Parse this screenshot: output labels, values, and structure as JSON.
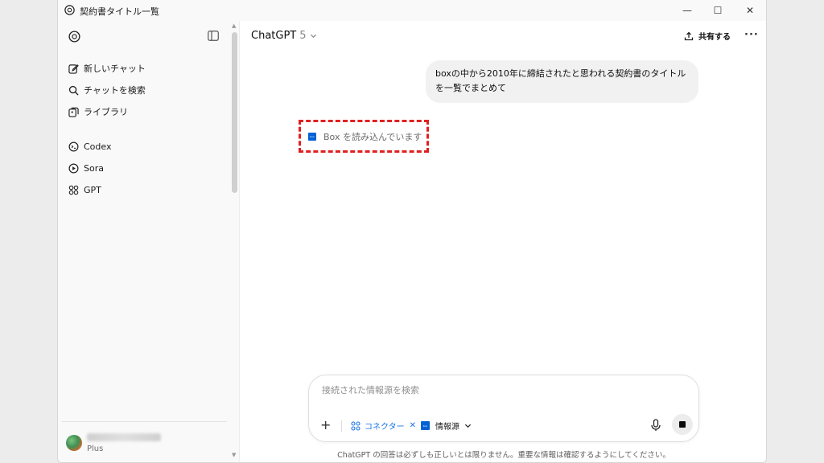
{
  "window": {
    "title": "契約書タイトル一覧",
    "controls": {
      "minimize": "—",
      "maximize": "☐",
      "close": "✕"
    }
  },
  "sidebar": {
    "items": [
      {
        "label": "新しいチャット",
        "icon": "edit-icon"
      },
      {
        "label": "チャットを検索",
        "icon": "search-icon"
      },
      {
        "label": "ライブラリ",
        "icon": "library-icon"
      },
      {
        "label": "Codex",
        "icon": "codex-icon"
      },
      {
        "label": "Sora",
        "icon": "sora-play-icon"
      },
      {
        "label": "GPT",
        "icon": "gpt-grid-icon"
      }
    ],
    "profile": {
      "plan": "Plus"
    }
  },
  "header": {
    "model_name": "ChatGPT",
    "model_version": "5",
    "share_label": "共有する",
    "more_label": "···"
  },
  "conversation": {
    "user_message": "boxの中から2010年に締結されたと思われる契約書のタイトルを一覧でまとめて",
    "status": {
      "icon_text": "box",
      "text": "Box を読み込んでいます"
    }
  },
  "composer": {
    "placeholder": "接続された情報源を検索",
    "plus_label": "+",
    "connector_label": "コネクター",
    "connector_remove": "✕",
    "source_label": "情報源",
    "source_icon_text": "box"
  },
  "footer": {
    "disclaimer": "ChatGPT の回答は必ずしも正しいとは限りません。重要な情報は確認するようにしてください。"
  },
  "colors": {
    "accent_blue": "#1a73e8",
    "box_brand": "#0061d5",
    "highlight_red": "#e02020"
  }
}
